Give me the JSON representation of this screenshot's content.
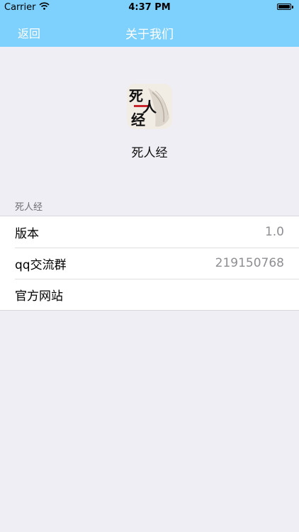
{
  "status_bar": {
    "carrier": "Carrier",
    "time": "4:37 PM",
    "wifi_icon": "wifi-icon",
    "battery_icon": "battery-icon"
  },
  "nav": {
    "back_label": "返回",
    "title": "关于我们",
    "color": "#7ed0fd"
  },
  "app": {
    "icon_text": "死人经",
    "name": "死人经"
  },
  "section": {
    "header": "死人经",
    "rows": [
      {
        "label": "版本",
        "value": "1.0"
      },
      {
        "label": "qq交流群",
        "value": "219150768"
      },
      {
        "label": "官方网站",
        "value": ""
      }
    ]
  }
}
